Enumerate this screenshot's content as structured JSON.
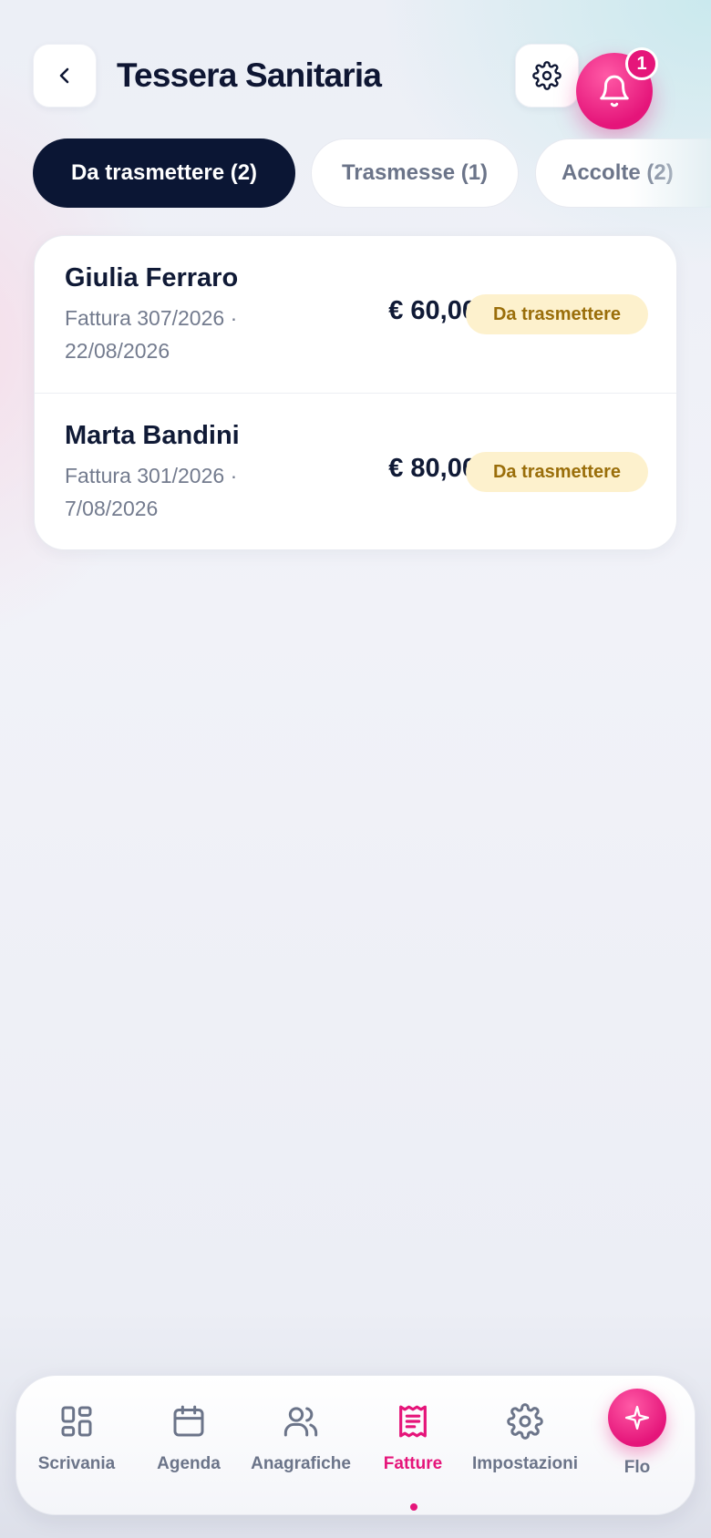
{
  "header": {
    "title": "Tessera Sanitaria",
    "notification_count": "1"
  },
  "tabs": [
    {
      "label": "Da trasmettere (2)",
      "active": true
    },
    {
      "label": "Trasmesse (1)"
    },
    {
      "label": "Accolte (2)"
    }
  ],
  "invoices": [
    {
      "name": "Giulia Ferraro",
      "meta": "Fattura 307/2026 · 22/08/2026",
      "amount": "€ 60,00",
      "status": "Da trasmettere"
    },
    {
      "name": "Marta Bandini",
      "meta": "Fattura 301/2026 · 7/08/2026",
      "amount": "€ 80,00",
      "status": "Da trasmettere"
    }
  ],
  "nav": [
    {
      "label": "Scrivania",
      "icon": "grid-icon"
    },
    {
      "label": "Agenda",
      "icon": "calendar-icon"
    },
    {
      "label": "Anagrafiche",
      "icon": "users-icon"
    },
    {
      "label": "Fatture",
      "icon": "receipt-icon",
      "active": true
    },
    {
      "label": "Impostazioni",
      "icon": "gear-icon"
    },
    {
      "label": "Flo",
      "icon": "sparkle-icon"
    }
  ],
  "colors": {
    "accent": "#e5157a",
    "dark": "#0b1634",
    "status_bg": "#fdf1cd",
    "status_text": "#9a6e0a"
  }
}
